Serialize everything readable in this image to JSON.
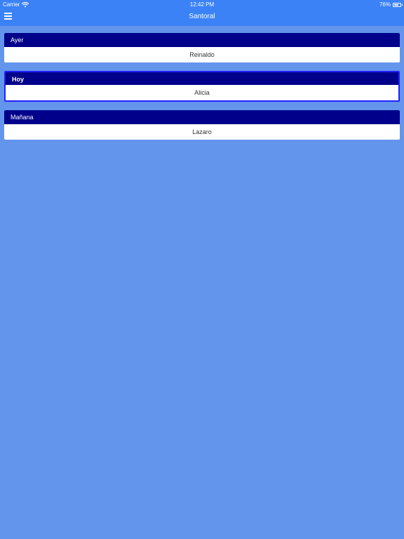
{
  "status_bar": {
    "carrier": "Carrier",
    "time": "12:42 PM",
    "battery_percent": "76%",
    "battery_level": 0.76
  },
  "navbar": {
    "title": "Santoral",
    "menu_icon": "hamburger-menu-icon"
  },
  "days": [
    {
      "label": "Ayer",
      "name": "Reinaldo",
      "selected": false
    },
    {
      "label": "Hoy",
      "name": "Alicia",
      "selected": true
    },
    {
      "label": "Mañana",
      "name": "Lazaro",
      "selected": false
    }
  ],
  "colors": {
    "background": "#6495ED",
    "navbar": "#3B82F6",
    "card_header": "#00008B",
    "selected_border": "#1F1FFF"
  }
}
